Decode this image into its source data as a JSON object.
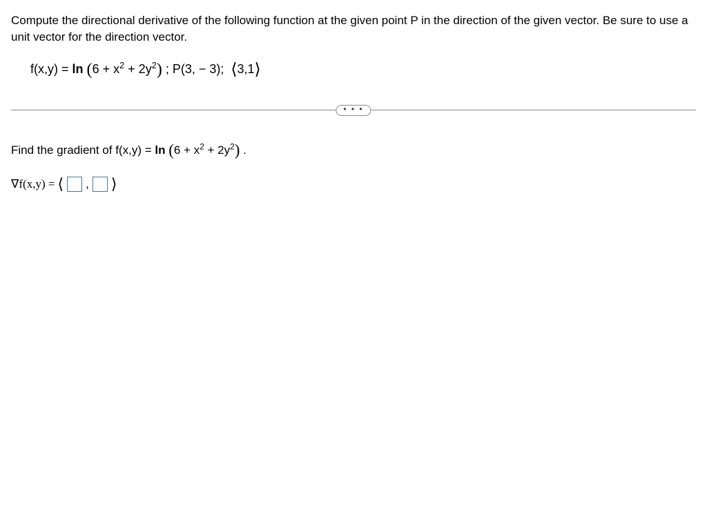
{
  "problem": {
    "statement": "Compute the directional derivative of the following function at the given point P in the direction of the given vector. Be sure to use a unit vector for the direction vector.",
    "function_label": "f(x,y) = ",
    "function_ln": "ln",
    "function_inner": "6 + x",
    "function_sq1": "2",
    "function_plus": " + 2y",
    "function_sq2": "2",
    "semicolon1": " ; ",
    "point": "P(3, − 3);",
    "vector_open": "⟨",
    "vector_content": "3,1",
    "vector_close": "⟩"
  },
  "separator": {
    "ellipsis": "• • •"
  },
  "question": {
    "prefix": "Find the gradient of f(x,y) = ",
    "ln": "ln",
    "inner1": "6 + x",
    "sq1": "2",
    "plus": " + 2y",
    "sq2": "2",
    "period": " ."
  },
  "answer": {
    "gradient": "∇f(x,y) = ",
    "angle_l": "⟨",
    "comma": ",",
    "angle_r": "⟩"
  }
}
